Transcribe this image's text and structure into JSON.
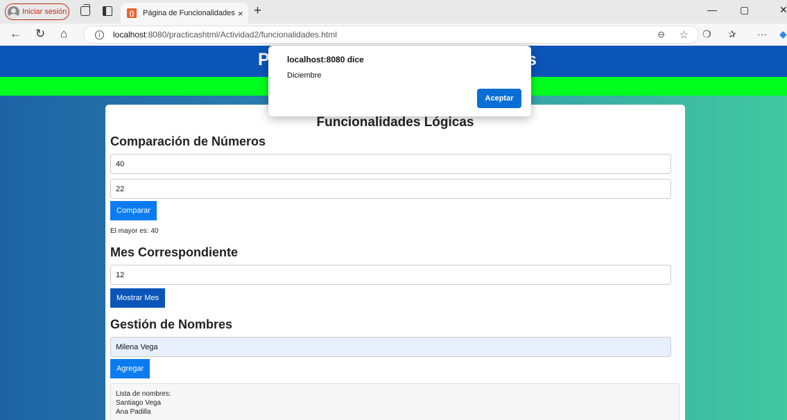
{
  "browser": {
    "signin_label": "Iniciar sesión",
    "tab_title": "Página de Funcionalidades Lógicas",
    "tab_close": "×",
    "new_tab": "+",
    "url_host": "localhost",
    "url_rest": ":8080/practicashtml/Actividad2/funcionalidades.html",
    "favicon_glyph": "{}"
  },
  "page": {
    "header_left": "P",
    "header_right": "s",
    "title": "Funcionalidades Lógicas",
    "comparison": {
      "heading": "Comparación de Números",
      "number1": "40",
      "number2": "22",
      "button": "Comparar",
      "result": "El mayor es: 40"
    },
    "month": {
      "heading": "Mes Correspondiente",
      "value": "12",
      "button": "Mostrar Mes"
    },
    "names": {
      "heading": "Gestión de Nombres",
      "value": "Milena Vega",
      "button": "Agregar",
      "list_title": "Lista de nombres:",
      "items": [
        "Santiago Vega",
        "Ana Padilla"
      ]
    }
  },
  "dialog": {
    "title": "localhost:8080 dice",
    "message": "Diciembre",
    "ok": "Aceptar"
  },
  "colors": {
    "header_blue": "#0b55b8",
    "green_bar": "#00ff1e",
    "button_blue": "#0a7cf0"
  }
}
